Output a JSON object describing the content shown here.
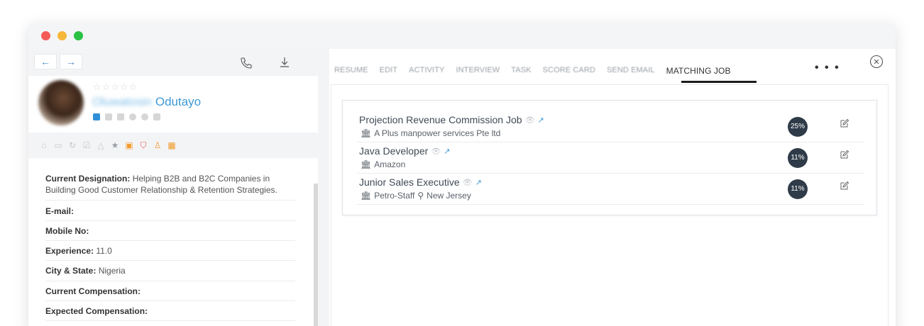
{
  "left": {
    "nav": {
      "back": "←",
      "forward": "→"
    },
    "profile": {
      "stars": "☆☆☆☆☆",
      "first_name": "Oluwatosin",
      "last_name": "Odutayo"
    },
    "details": [
      {
        "label": "Current Designation:",
        "value": "Helping B2B and B2C Companies in Building Good Customer Relationship & Retention Strategies."
      },
      {
        "label": "E-mail:",
        "value": ""
      },
      {
        "label": "Mobile No:",
        "value": ""
      },
      {
        "label": "Experience:",
        "value": "11.0"
      },
      {
        "label": "City & State:",
        "value": "Nigeria"
      },
      {
        "label": "Current Compensation:",
        "value": ""
      },
      {
        "label": "Expected Compensation:",
        "value": ""
      }
    ]
  },
  "tabs": [
    "RESUME",
    "EDIT",
    "ACTIVITY",
    "INTERVIEW",
    "TASK",
    "SCORE CARD",
    "SEND EMAIL",
    "MATCHING JOB"
  ],
  "more_label": "• • •",
  "jobs": [
    {
      "title": "Projection Revenue Commission Job",
      "company": "A Plus manpower services Pte ltd",
      "location": "",
      "match": "25%"
    },
    {
      "title": "Java Developer",
      "company": "Amazon",
      "location": "",
      "match": "11%"
    },
    {
      "title": "Junior Sales Executive",
      "company": "Petro-Staff",
      "location": "New Jersey",
      "match": "11%"
    }
  ],
  "icons": {
    "eye": "👁",
    "external": "↗",
    "company": "🏛",
    "location": "⚲"
  },
  "colors": {
    "accent": "#3d9ad6",
    "badge": "#2f3b48"
  }
}
